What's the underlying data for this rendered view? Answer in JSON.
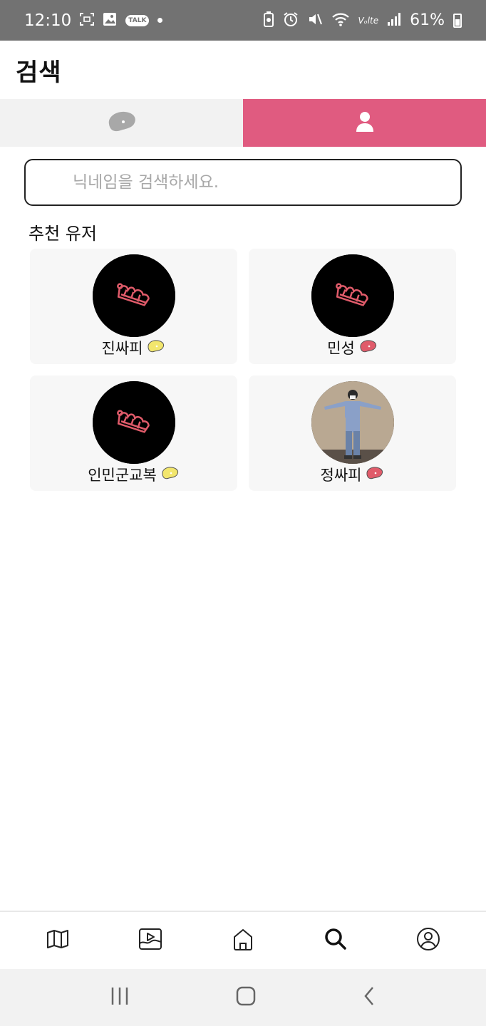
{
  "status_bar": {
    "time": "12:10",
    "battery": "61%",
    "talk_badge": "TALK",
    "signal_label": "Vₒlte"
  },
  "header": {
    "title": "검색"
  },
  "tabs": [
    {
      "name": "bean",
      "icon": "coffee-bean-icon",
      "active": false
    },
    {
      "name": "user",
      "icon": "user-icon",
      "active": true
    }
  ],
  "search": {
    "placeholder": "닉네임을 검색하세요.",
    "value": ""
  },
  "section": {
    "title": "추천 유저"
  },
  "users": [
    {
      "nickname": "진싸피",
      "bean_color": "#f2e66d",
      "avatar": "logo-avatar"
    },
    {
      "nickname": "민성",
      "bean_color": "#e05b6a",
      "avatar": "logo-avatar"
    },
    {
      "nickname": "인민군교복",
      "bean_color": "#f2e66d",
      "avatar": "logo-avatar"
    },
    {
      "nickname": "정싸피",
      "bean_color": "#e05b6a",
      "avatar": "photo-avatar"
    }
  ],
  "bottom_nav": [
    {
      "icon": "map-icon"
    },
    {
      "icon": "video-icon"
    },
    {
      "icon": "home-icon"
    },
    {
      "icon": "search-icon",
      "active": true
    },
    {
      "icon": "profile-icon"
    }
  ],
  "colors": {
    "accent": "#e05b80",
    "status_bar": "#727272"
  }
}
